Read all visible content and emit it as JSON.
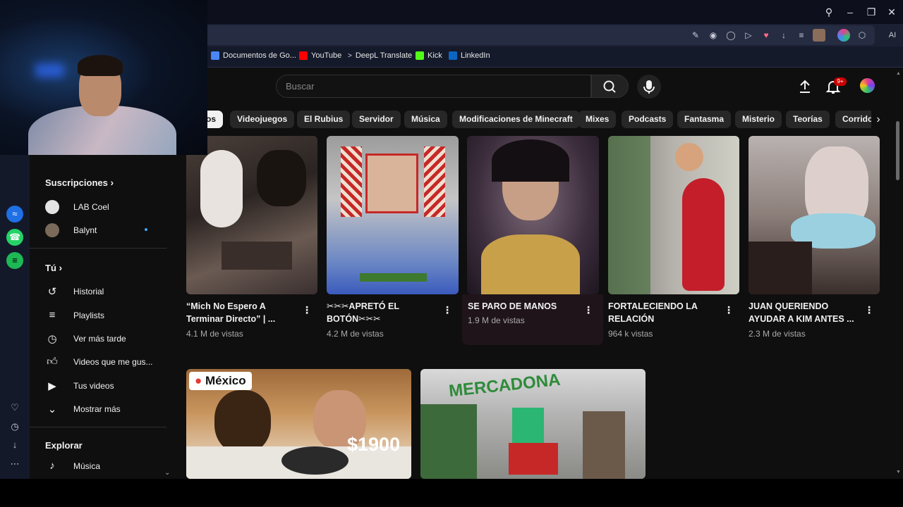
{
  "bookmarks": [
    {
      "label": "Documentos de Go...",
      "icon": "docs-icon",
      "color": "#4a86f5"
    },
    {
      "label": "YouTube",
      "icon": "youtube-icon",
      "color": "#ff0000"
    },
    {
      "label": "DeepL Translate",
      "icon": "deepl-icon",
      "color": "#cfd3e0"
    },
    {
      "label": "Kick",
      "icon": "kick-icon",
      "color": "#53fc18"
    },
    {
      "label": "LinkedIn",
      "icon": "linkedin-icon",
      "color": "#0a66c2"
    }
  ],
  "toolbar": {
    "ai_label": "AI"
  },
  "header": {
    "search_placeholder": "Buscar",
    "notifications_badge": "9+"
  },
  "chips": [
    "os",
    "Videojuegos",
    "El Rubius",
    "Servidor",
    "Música",
    "Modificaciones de Minecraft",
    "Mixes",
    "Podcasts",
    "Fantasma",
    "Misterio",
    "Teorías",
    "Corrido"
  ],
  "sidebar": {
    "subscriptions_heading": "Suscripciones",
    "subscriptions": [
      {
        "label": "LAB Coel"
      },
      {
        "label": "Balynt"
      }
    ],
    "you_heading": "Tú",
    "you_items": [
      {
        "label": "Historial",
        "icon": "history-icon"
      },
      {
        "label": "Playlists",
        "icon": "playlists-icon"
      },
      {
        "label": "Ver más tarde",
        "icon": "watch-later-icon"
      },
      {
        "label": "Videos que me gus...",
        "icon": "liked-videos-icon"
      },
      {
        "label": "Tus videos",
        "icon": "your-videos-icon"
      },
      {
        "label": "Mostrar más",
        "icon": "chevron-down-icon"
      }
    ],
    "explore_heading": "Explorar",
    "explore_items": [
      {
        "label": "Música",
        "icon": "music-icon"
      }
    ]
  },
  "videos": [
    {
      "title": "“Mich No Espero A Terminar Directo” | ...",
      "views": "4.1 M de vistas"
    },
    {
      "title": "✂✂✂APRETÓ EL BOTÓN✂✂✂",
      "views": "4.2 M de vistas"
    },
    {
      "title": "SE PARO DE MANOS",
      "views": "1.9 M de vistas"
    },
    {
      "title": "FORTALECIENDO LA RELACIÓN",
      "views": "964 k vistas"
    },
    {
      "title": "JUAN QUERIENDO AYUDAR A KIM ANTES ...",
      "views": "2.3 M de vistas"
    }
  ],
  "row2": [
    {
      "overlay_tag": "México",
      "overlay_price": "$1900"
    },
    {
      "overlay_logo": "MERCADONA"
    }
  ]
}
